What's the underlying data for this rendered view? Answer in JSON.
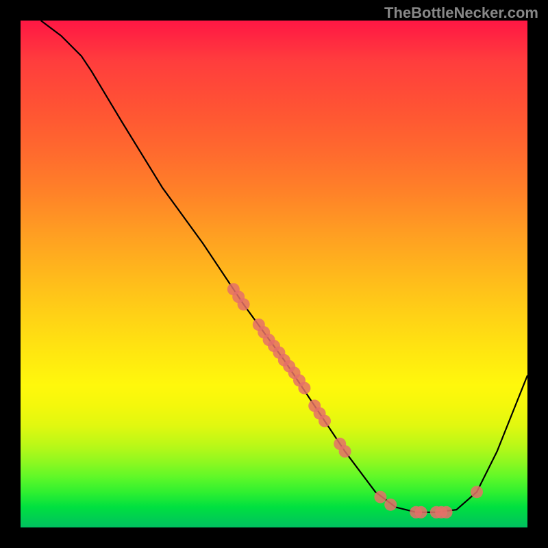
{
  "attribution": "TheBottleNecker.com",
  "chart_data": {
    "type": "line",
    "title": "",
    "xlabel": "",
    "ylabel": "",
    "xlim": [
      0,
      100
    ],
    "ylim": [
      0,
      100
    ],
    "curve_notes": "V-shaped bottleneck curve: steep descent from ~(4,100) to trough region ~(72-88, ~3) then rise to ~(100,30).",
    "curve": [
      {
        "x": 4,
        "y": 100
      },
      {
        "x": 8,
        "y": 97
      },
      {
        "x": 12,
        "y": 93
      },
      {
        "x": 14,
        "y": 90
      },
      {
        "x": 20,
        "y": 80
      },
      {
        "x": 28,
        "y": 67
      },
      {
        "x": 36,
        "y": 56
      },
      {
        "x": 44,
        "y": 44
      },
      {
        "x": 52,
        "y": 33
      },
      {
        "x": 58,
        "y": 24
      },
      {
        "x": 64,
        "y": 15
      },
      {
        "x": 70,
        "y": 7
      },
      {
        "x": 74,
        "y": 4
      },
      {
        "x": 78,
        "y": 3
      },
      {
        "x": 82,
        "y": 3
      },
      {
        "x": 86,
        "y": 3.5
      },
      {
        "x": 90,
        "y": 7
      },
      {
        "x": 94,
        "y": 15
      },
      {
        "x": 98,
        "y": 25
      },
      {
        "x": 100,
        "y": 30
      }
    ],
    "points": [
      {
        "x": 42,
        "y": 47
      },
      {
        "x": 43,
        "y": 45.5
      },
      {
        "x": 44,
        "y": 44
      },
      {
        "x": 47,
        "y": 40
      },
      {
        "x": 48,
        "y": 38.5
      },
      {
        "x": 49,
        "y": 37
      },
      {
        "x": 50,
        "y": 35.8
      },
      {
        "x": 51,
        "y": 34.5
      },
      {
        "x": 52,
        "y": 33
      },
      {
        "x": 53,
        "y": 31.8
      },
      {
        "x": 54,
        "y": 30.5
      },
      {
        "x": 55,
        "y": 29
      },
      {
        "x": 56,
        "y": 27.5
      },
      {
        "x": 58,
        "y": 24
      },
      {
        "x": 59,
        "y": 22.5
      },
      {
        "x": 60,
        "y": 21
      },
      {
        "x": 63,
        "y": 16.5
      },
      {
        "x": 64,
        "y": 15
      },
      {
        "x": 71,
        "y": 6
      },
      {
        "x": 73,
        "y": 4.5
      },
      {
        "x": 78,
        "y": 3
      },
      {
        "x": 79,
        "y": 3
      },
      {
        "x": 82,
        "y": 3
      },
      {
        "x": 83,
        "y": 3
      },
      {
        "x": 84,
        "y": 3
      },
      {
        "x": 90,
        "y": 7
      }
    ],
    "point_color": "#e57069"
  }
}
